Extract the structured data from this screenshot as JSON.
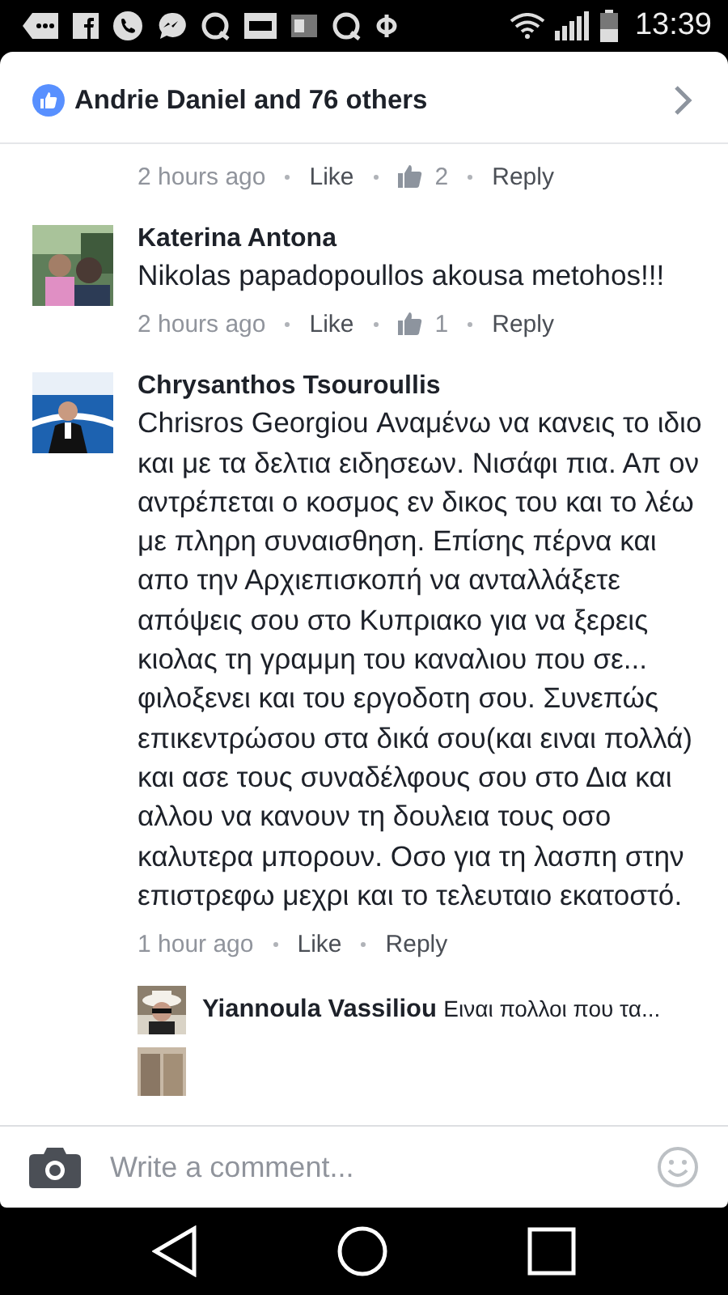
{
  "status_bar": {
    "time": "13:39"
  },
  "likes_bar": {
    "text": "Andrie Daniel and 76 others"
  },
  "comments": [
    {
      "kind": "meta",
      "time": "2 hours ago",
      "like": "Like",
      "likes": "2",
      "reply": "Reply"
    },
    {
      "kind": "comment",
      "name": "Katerina Antona",
      "text": "Nikolas papadopoullos akousa metohos!!!",
      "time": "2 hours ago",
      "like": "Like",
      "likes": "1",
      "reply": "Reply"
    },
    {
      "kind": "comment",
      "name": "Chrysanthos Tsouroullis",
      "text": "Chrisros Georgiou Αναμένω να κανεις το ιδιο και με τα δελτια ειδησεων. Νισάφι πια. Απ ον αντρέπεται ο κοσμος εν δικος του και το λέω με πληρη συναισθηση. Επίσης πέρνα και απο την Αρχιεπισκοπή να ανταλλάξετε απόψεις σου στο Κυπριακο για να ξερεις κιολας τη γραμμη του καναλιου που σε... φιλοξενει και του εργοδοτη σου. Συνεπώς επικεντρώσου στα δικά σου(και ειναι πολλά) και ασε τους συναδέλφους σου στο Δια και αλλου να κανουν τη δουλεια τους οσο καλυτερα μπορουν. Οσο για τη λασπη στην επιστρεφω μεχρι και το τελευταιο εκατοστό.",
      "time": "1 hour ago",
      "like": "Like",
      "reply": "Reply",
      "replies": [
        {
          "name": "Yiannoula Vassiliou",
          "text": "Ειναι πολλοι που τα..."
        },
        {
          "kind": "picture"
        }
      ]
    }
  ],
  "composer": {
    "placeholder": "Write a comment..."
  }
}
